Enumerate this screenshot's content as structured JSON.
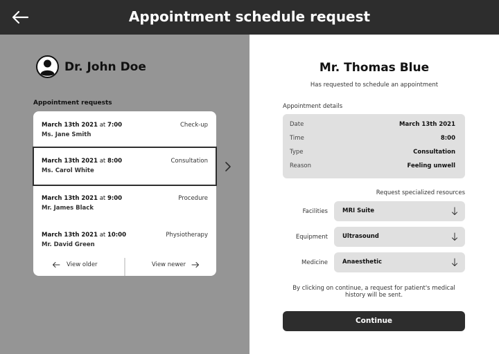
{
  "header": {
    "title": "Appointment schedule request",
    "back_icon": "arrow-left-icon"
  },
  "doctor": {
    "name": "Dr. John Doe",
    "avatar_icon": "user-avatar-icon"
  },
  "appointments": {
    "label": "Appointment requests",
    "items": [
      {
        "date": "March 13th 2021",
        "at": "at",
        "time": "7:00",
        "patient": "Ms. Jane Smith",
        "type": "Check-up",
        "selected": false
      },
      {
        "date": "March 13th 2021",
        "at": "at",
        "time": "8:00",
        "patient": "Ms. Carol White",
        "type": "Consultation",
        "selected": true
      },
      {
        "date": "March 13th 2021",
        "at": "at",
        "time": "9:00",
        "patient": "Mr. James Black",
        "type": "Procedure",
        "selected": false
      },
      {
        "date": "March 13th 2021",
        "at": "at",
        "time": "10:00",
        "patient": "Mr. David Green",
        "type": "Physiotherapy",
        "selected": false
      }
    ],
    "view_older": "View older",
    "view_newer": "View newer"
  },
  "patient": {
    "name": "Mr. Thomas Blue",
    "subtitle": "Has requested to schedule an appointment"
  },
  "details": {
    "label": "Appointment details",
    "rows": [
      {
        "key": "Date",
        "value": "March 13th 2021"
      },
      {
        "key": "Time",
        "value": "8:00"
      },
      {
        "key": "Type",
        "value": "Consultation"
      },
      {
        "key": "Reason",
        "value": "Feeling unwell"
      }
    ]
  },
  "resources": {
    "title": "Request specialized resources",
    "fields": [
      {
        "label": "Facilities",
        "value": "MRI Suite"
      },
      {
        "label": "Equipment",
        "value": "Ultrasound"
      },
      {
        "label": "Medicine",
        "value": "Anaesthetic"
      }
    ]
  },
  "notice": "By clicking on continue, a request for patient's medical history will be sent.",
  "continue_label": "Continue",
  "colors": {
    "dark": "#2d2d2d",
    "panel_gray": "#959595",
    "field_gray": "#e0e0e0"
  }
}
